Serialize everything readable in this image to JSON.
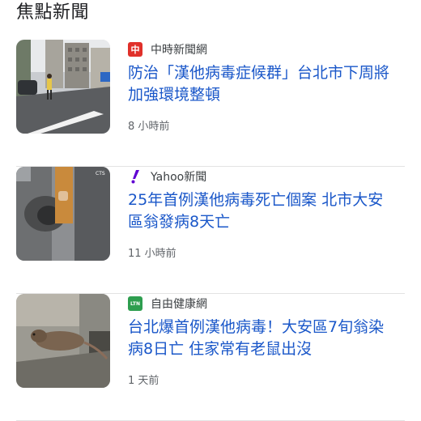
{
  "section": {
    "title": "焦點新聞"
  },
  "articles": [
    {
      "source": "中時新聞網",
      "logo_icon": "chinatimes-logo-icon",
      "logo_char": "中",
      "logo_color": "#e0302a",
      "headline": "防治「漢他病毒症候群」台北市下周將加強環境整頓",
      "time": "8 小時前"
    },
    {
      "source": "Yahoo新聞",
      "logo_icon": "yahoo-logo-icon",
      "logo_char": "/",
      "logo_color": "#6001d2",
      "headline": "25年首例漢他病毒死亡個案 北市大安區翁發病8天亡",
      "time": "11 小時前"
    },
    {
      "source": "自由健康網",
      "logo_icon": "ltn-logo-icon",
      "logo_char": "LTN",
      "logo_color": "#2e9e4f",
      "headline": "台北爆首例漢他病毒！大安區7旬翁染病8日亡 住家常有老鼠出沒",
      "time": "1 天前"
    }
  ],
  "colors": {
    "headline": "#1a57c9",
    "meta": "#5f6368",
    "divider": "#e3e3e3"
  }
}
